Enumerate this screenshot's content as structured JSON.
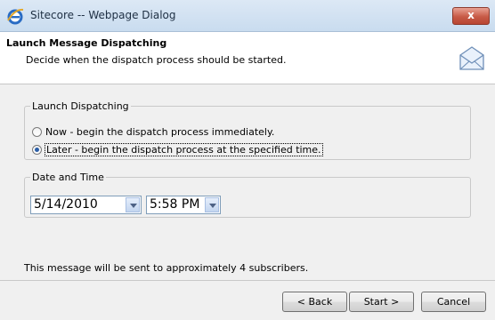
{
  "window": {
    "title": "Sitecore -- Webpage Dialog",
    "close_label": "x"
  },
  "header": {
    "title": "Launch Message Dispatching",
    "subtitle": "Decide when the dispatch process should be started."
  },
  "launch_dispatching": {
    "legend": "Launch Dispatching",
    "options": [
      {
        "label": "Now - begin the dispatch process immediately.",
        "checked": false
      },
      {
        "label": "Later - begin the dispatch process at the specified time.",
        "checked": true
      }
    ]
  },
  "date_time": {
    "legend": "Date and Time",
    "date_value": "5/14/2010",
    "time_value": "5:58 PM"
  },
  "info": {
    "text": "This message will be sent to approximately 4 subscribers."
  },
  "buttons": {
    "back": "< Back",
    "start": "Start >",
    "cancel": "Cancel"
  }
}
